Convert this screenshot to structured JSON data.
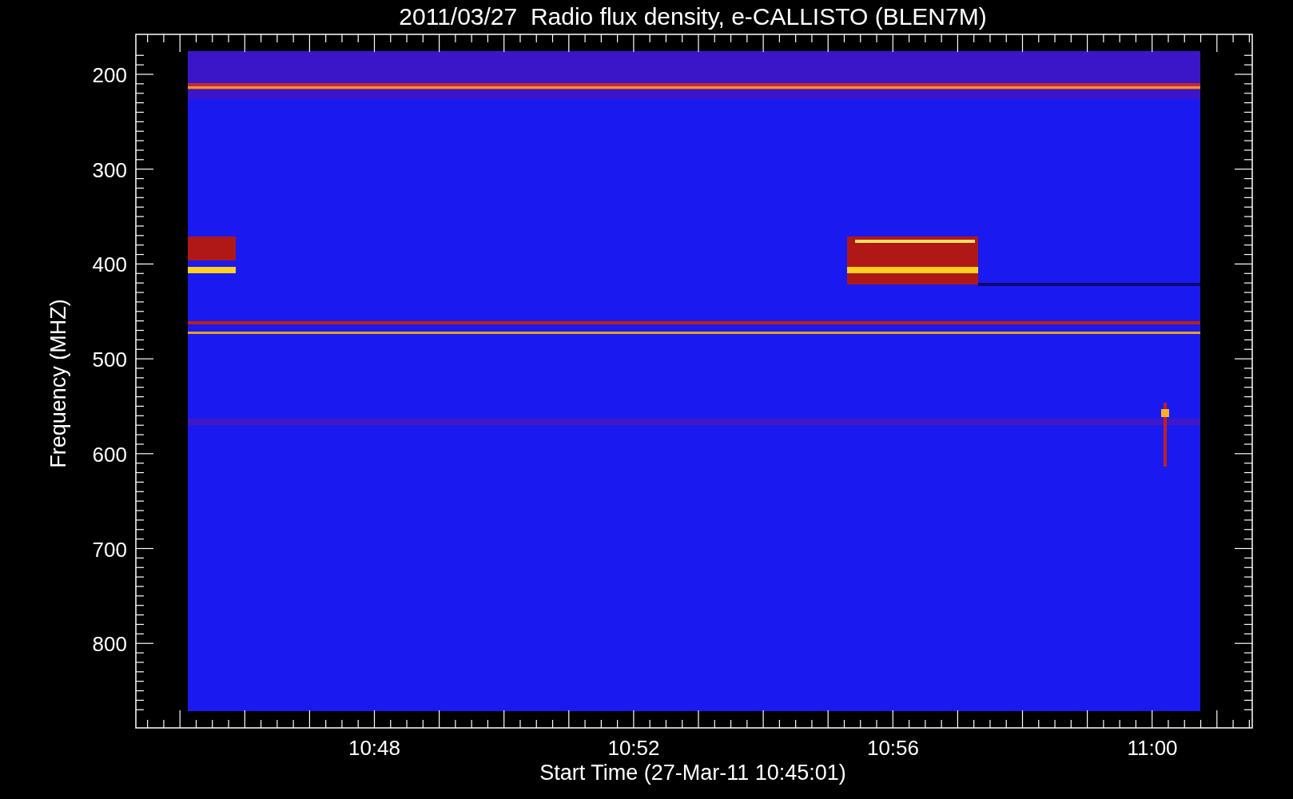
{
  "title": "2011/03/27  Radio flux density, e-CALLISTO (BLEN7M)",
  "y_axis": {
    "label": "Frequency (MHZ)",
    "ticks": [
      "200",
      "300",
      "400",
      "500",
      "600",
      "700",
      "800"
    ]
  },
  "x_axis": {
    "label": "Start Time (27-Mar-11 10:45:01)",
    "ticks": [
      "10:48",
      "10:52",
      "10:56",
      "11:00"
    ]
  }
}
